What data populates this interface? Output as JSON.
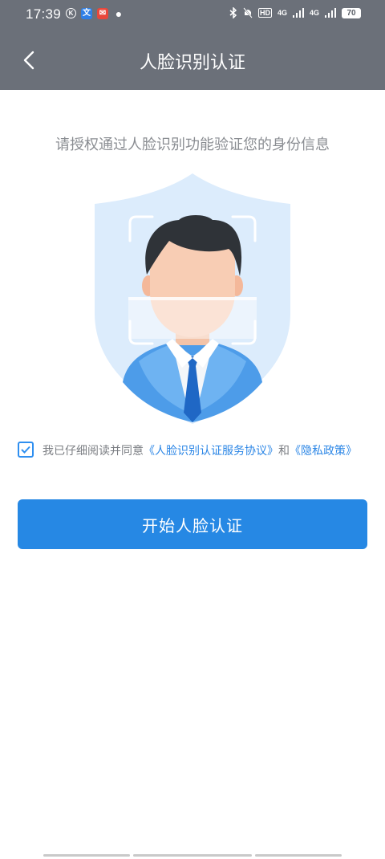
{
  "status_bar": {
    "time": "17:39",
    "left_icons": [
      "k-app-icon",
      "translate-app-icon",
      "mail-app-icon",
      "chat-bubble-icon"
    ],
    "hd_label": "HD",
    "network_1": "4G",
    "network_2": "4G",
    "battery": "70"
  },
  "header": {
    "title": "人脸识别认证",
    "back_icon": "chevron-left-icon"
  },
  "main": {
    "subtitle": "请授权通过人脸识别功能验证您的身份信息",
    "illustration_icon": "face-scan-shield-icon",
    "agreement": {
      "checked": true,
      "prefix": "我已仔细阅读并同意",
      "link1": "《人脸识别认证服务协议》",
      "middle": "和",
      "link2": "《隐私政策》"
    },
    "start_button_label": "开始人脸认证"
  },
  "colors": {
    "header_bg": "#6b7079",
    "accent": "#2688e4",
    "link": "#2b86e6",
    "shield": "#dcecfc"
  }
}
